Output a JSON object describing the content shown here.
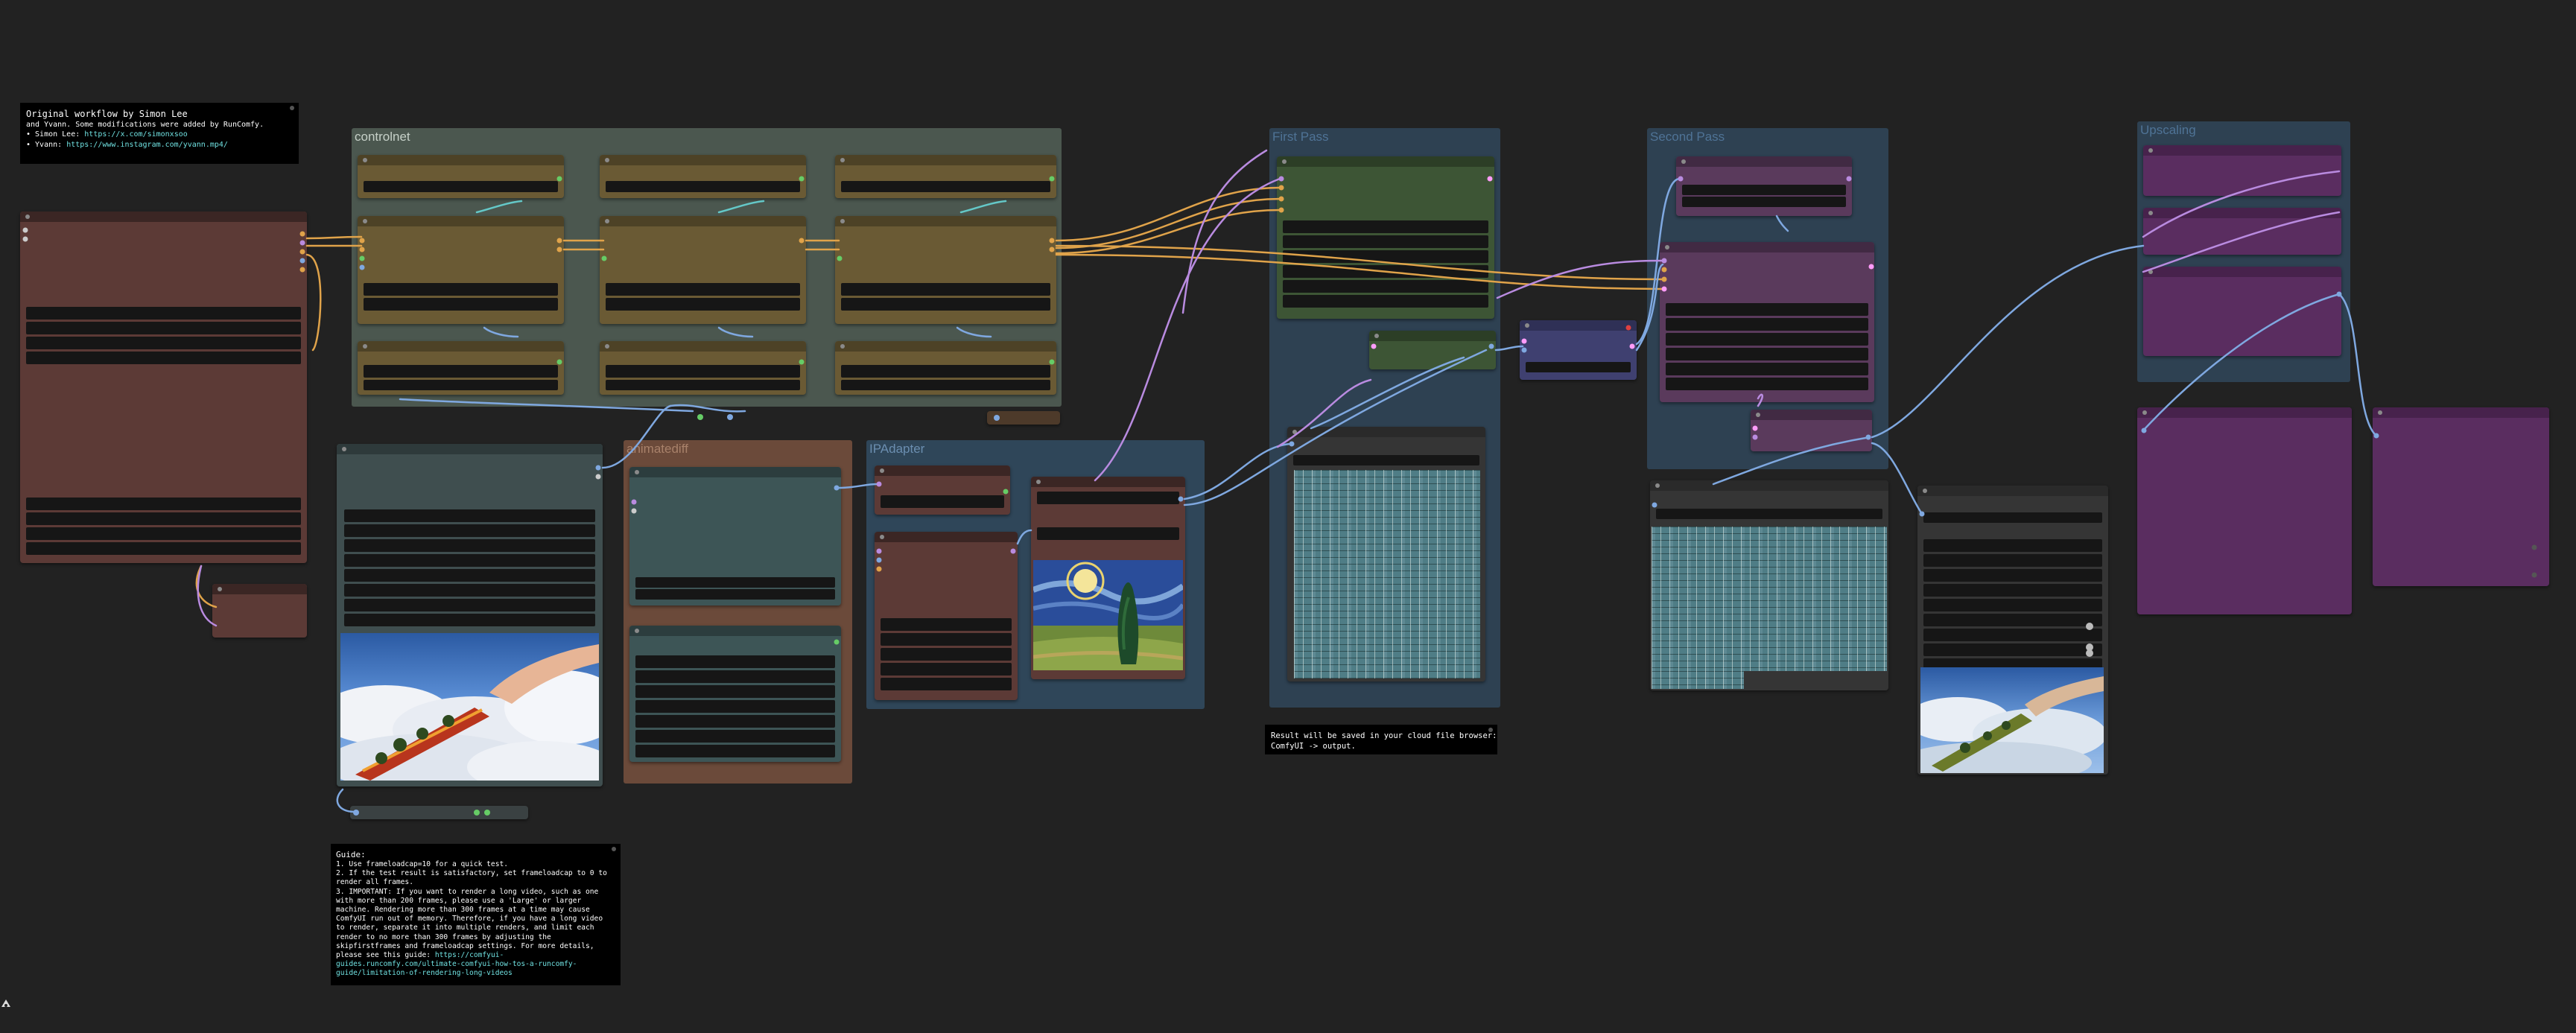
{
  "app": {
    "name": "ComfyUI workflow canvas",
    "background": "#222222"
  },
  "notes": {
    "credits": {
      "lines": [
        "Original workflow by Simon Lee",
        "and Yvann. Some modifications were added by RunComfy."
      ],
      "links": [
        {
          "prefix": "• Simon Lee: ",
          "url": "https://x.com/simonxsoo"
        },
        {
          "prefix": "• Yvann: ",
          "url": "https://www.instagram.com/yvann.mp4/"
        }
      ]
    },
    "guide": {
      "lines": [
        "Guide:",
        "1. Use frameloadcap=10 for a quick test.",
        "2. If the test result is satisfactory, set frameloadcap to 0 to",
        "render all frames.",
        "3. IMPORTANT: If you want to render a long video, such as one",
        "with more than 200 frames, please use a 'Large' or larger",
        "machine. Rendering more than 300 frames at a time may cause",
        "ComfyUI run out of memory. Therefore, if you have a long video",
        "to render, separate it into multiple renders, and limit each",
        "render to no more than 300 frames by adjusting the",
        "skipfirstframes and frameloadcap settings. For more details,",
        "please see this guide: "
      ],
      "link_lines": [
        "https://comfyui-",
        "guides.runcomfy.com/ultimate-comfyui-how-tos-a-runcomfy-",
        "guide/limitation-of-rendering-long-videos"
      ]
    },
    "output": {
      "lines": [
        "Result will be saved in your cloud file browser:",
        "ComfyUI -> output."
      ]
    }
  },
  "groups": {
    "controlnet": "controlnet",
    "animatediff": "animatediff",
    "ipadapter": "IPAdapter",
    "first_pass": "First Pass",
    "second_pass": "Second Pass",
    "upscaling": "Upscaling"
  },
  "colors": {
    "wire_orange": "#e0a34a",
    "wire_blue": "#7fa8e0",
    "wire_purple": "#b98be0",
    "wire_cyan": "#64c8c8",
    "group_controlnet": "#4b574f",
    "group_animatediff": "#6b4a3a",
    "group_ipadapter": "#2f4659",
    "group_blue": "#2e4152",
    "group_purple": "#57335f",
    "node_brown": "#5c3a36",
    "node_gold": "#6a5a34",
    "node_green": "#3d5535",
    "node_teal": "#3d5556",
    "node_magenta": "#5a3a5c",
    "node_violet": "#5a2d60",
    "node_indigo": "#3f4070"
  },
  "icons": {
    "bottom_left": "comfy-logo-icon"
  }
}
